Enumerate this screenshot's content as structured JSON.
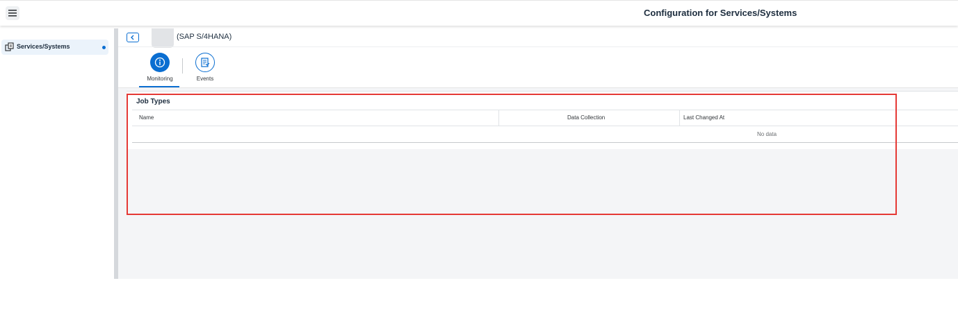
{
  "shell": {
    "title": "Configuration for Services/Systems",
    "menu_icon": "hamburger-menu-icon"
  },
  "sidebar": {
    "items": [
      {
        "label": "Services/Systems",
        "icon": "services-systems-icon",
        "selected": true
      }
    ]
  },
  "object_header": {
    "title": "(SAP S/4HANA)",
    "back_icon": "back-arrow-icon"
  },
  "tabs": [
    {
      "label": "Monitoring",
      "icon": "info-icon",
      "selected": true
    },
    {
      "label": "Events",
      "icon": "events-list-icon",
      "selected": false
    }
  ],
  "job_types": {
    "title": "Job Types",
    "columns": [
      "Name",
      "Data Collection",
      "Last Changed At"
    ],
    "rows": [],
    "empty_text": "No data"
  },
  "colors": {
    "accent": "#0a6ed1",
    "highlight_box": "#e53935",
    "content_bg": "#f4f5f7"
  }
}
